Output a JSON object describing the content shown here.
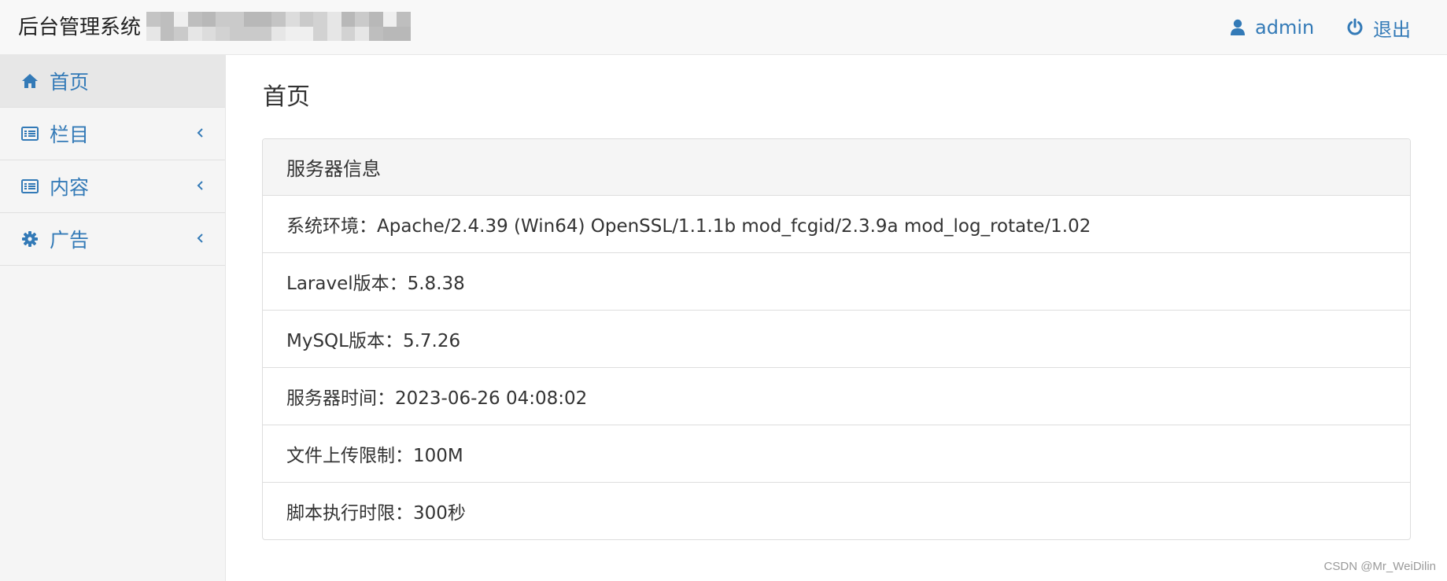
{
  "header": {
    "brand": "后台管理系统",
    "user_label": "admin",
    "logout_label": "退出"
  },
  "sidebar": {
    "items": [
      {
        "label": "首页",
        "icon": "home-icon",
        "active": true
      },
      {
        "label": "栏目",
        "icon": "list-icon",
        "active": false
      },
      {
        "label": "内容",
        "icon": "list-icon",
        "active": false
      },
      {
        "label": "广告",
        "icon": "gear-icon",
        "active": false
      }
    ]
  },
  "main": {
    "title": "首页",
    "panel": {
      "heading": "服务器信息",
      "rows": [
        "系统环境：Apache/2.4.39 (Win64) OpenSSL/1.1.1b mod_fcgid/2.3.9a mod_log_rotate/1.02",
        "Laravel版本：5.8.38",
        "MySQL版本：5.7.26",
        "服务器时间：2023-06-26 04:08:02",
        "文件上传限制：100M",
        "脚本执行时限：300秒"
      ]
    }
  },
  "watermark": "CSDN @Mr_WeiDilin",
  "colors": {
    "link": "#337ab7",
    "navbar_bg": "#f8f8f8",
    "sidebar_bg": "#f5f5f5",
    "active_bg": "#e7e7e7"
  }
}
